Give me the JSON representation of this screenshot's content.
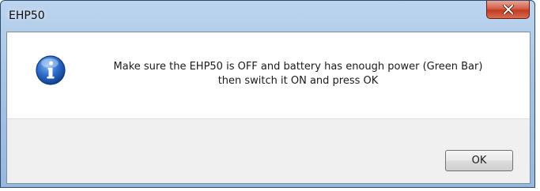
{
  "window": {
    "title": "EHP50",
    "close_icon": "close-icon",
    "close_color": "#c7432a"
  },
  "dialog": {
    "icon": "info-icon",
    "message_line1": "Make sure the EHP50 is OFF and battery has enough power (Green Bar)",
    "message_line2": "then switch it ON and press OK",
    "ok_label": "OK"
  }
}
